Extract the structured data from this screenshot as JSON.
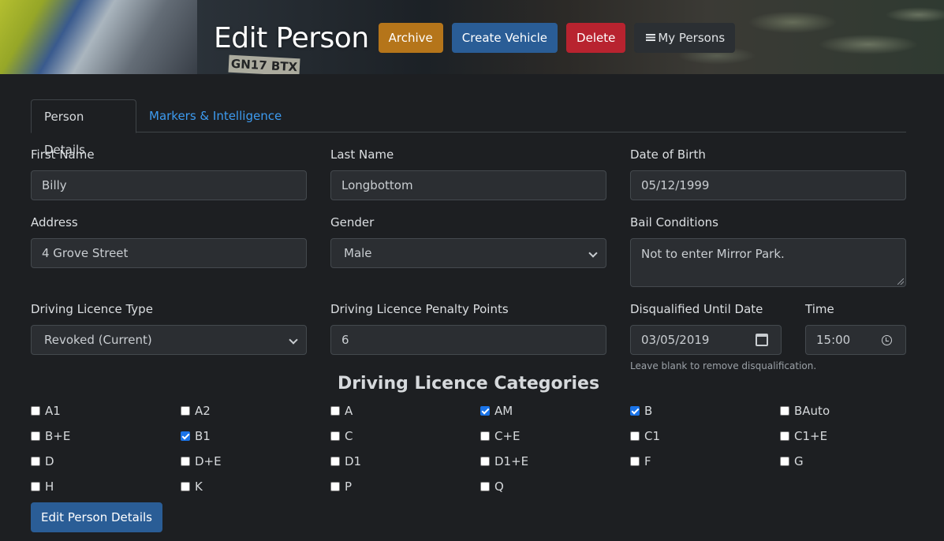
{
  "header": {
    "title": "Edit Person",
    "plate": "GN17 BTX",
    "buttons": {
      "archive": "Archive",
      "create_vehicle": "Create Vehicle",
      "delete": "Delete",
      "my_persons": "My Persons"
    }
  },
  "tabs": [
    {
      "label": "Person Details",
      "active": true
    },
    {
      "label": "Markers & Intelligence",
      "active": false
    }
  ],
  "form": {
    "first_name": {
      "label": "First Name",
      "value": "Billy"
    },
    "last_name": {
      "label": "Last Name",
      "value": "Longbottom"
    },
    "dob": {
      "label": "Date of Birth",
      "value": "05/12/1999"
    },
    "address": {
      "label": "Address",
      "value": "4 Grove Street"
    },
    "gender": {
      "label": "Gender",
      "value": "Male"
    },
    "bail": {
      "label": "Bail Conditions",
      "value": "Not to enter Mirror Park."
    },
    "licence_type": {
      "label": "Driving Licence Type",
      "value": "Revoked (Current)"
    },
    "penalty_points": {
      "label": "Driving Licence Penalty Points",
      "value": "6"
    },
    "disqualified_date": {
      "label": "Disqualified Until Date",
      "value": "03/05/2019"
    },
    "disqualified_time": {
      "label": "Time",
      "value": "15:00"
    },
    "disqualified_help": "Leave blank to remove disqualification."
  },
  "categories": {
    "title": "Driving Licence Categories",
    "items": [
      {
        "label": "A1",
        "checked": false
      },
      {
        "label": "A2",
        "checked": false
      },
      {
        "label": "A",
        "checked": false
      },
      {
        "label": "AM",
        "checked": true
      },
      {
        "label": "B",
        "checked": true
      },
      {
        "label": "BAuto",
        "checked": false
      },
      {
        "label": "B+E",
        "checked": false
      },
      {
        "label": "B1",
        "checked": true
      },
      {
        "label": "C",
        "checked": false
      },
      {
        "label": "C+E",
        "checked": false
      },
      {
        "label": "C1",
        "checked": false
      },
      {
        "label": "C1+E",
        "checked": false
      },
      {
        "label": "D",
        "checked": false
      },
      {
        "label": "D+E",
        "checked": false
      },
      {
        "label": "D1",
        "checked": false
      },
      {
        "label": "D1+E",
        "checked": false
      },
      {
        "label": "F",
        "checked": false
      },
      {
        "label": "G",
        "checked": false
      },
      {
        "label": "H",
        "checked": false
      },
      {
        "label": "K",
        "checked": false
      },
      {
        "label": "P",
        "checked": false
      },
      {
        "label": "Q",
        "checked": false
      }
    ]
  },
  "submit_label": "Edit Person Details"
}
